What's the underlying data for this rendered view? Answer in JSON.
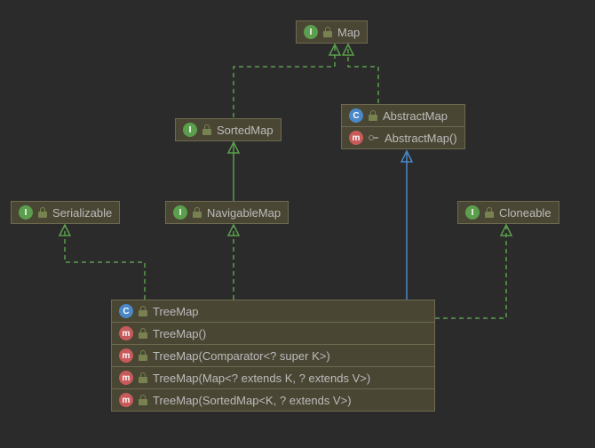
{
  "nodes": {
    "map": {
      "kind": "interface",
      "label": "Map"
    },
    "sortedMap": {
      "kind": "interface",
      "label": "SortedMap"
    },
    "abstractMap": {
      "kind": "class",
      "label": "AbstractMap",
      "members": [
        {
          "kind": "method",
          "vis": "protected",
          "label": "AbstractMap()"
        }
      ]
    },
    "serializable": {
      "kind": "interface",
      "label": "Serializable"
    },
    "navigableMap": {
      "kind": "interface",
      "label": "NavigableMap"
    },
    "cloneable": {
      "kind": "interface",
      "label": "Cloneable"
    },
    "treeMap": {
      "kind": "class",
      "label": "TreeMap",
      "members": [
        {
          "kind": "method",
          "vis": "public",
          "label": "TreeMap()"
        },
        {
          "kind": "method",
          "vis": "public",
          "label": "TreeMap(Comparator<? super K>)"
        },
        {
          "kind": "method",
          "vis": "public",
          "label": "TreeMap(Map<? extends K, ? extends V>)"
        },
        {
          "kind": "method",
          "vis": "public",
          "label": "TreeMap(SortedMap<K, ? extends V>)"
        }
      ]
    }
  },
  "edges": [
    {
      "from": "sortedMap",
      "to": "map",
      "type": "implements"
    },
    {
      "from": "abstractMap",
      "to": "map",
      "type": "implements"
    },
    {
      "from": "navigableMap",
      "to": "sortedMap",
      "type": "implements"
    },
    {
      "from": "treeMap",
      "to": "serializable",
      "type": "implements"
    },
    {
      "from": "treeMap",
      "to": "navigableMap",
      "type": "implements"
    },
    {
      "from": "treeMap",
      "to": "abstractMap",
      "type": "extends"
    },
    {
      "from": "treeMap",
      "to": "cloneable",
      "type": "implements"
    }
  ],
  "colors": {
    "implements": "#5b9e4d",
    "extends": "#4a88c7",
    "nodeFill": "#4a4634",
    "nodeBorder": "#6e6a50",
    "background": "#2b2b2b"
  }
}
